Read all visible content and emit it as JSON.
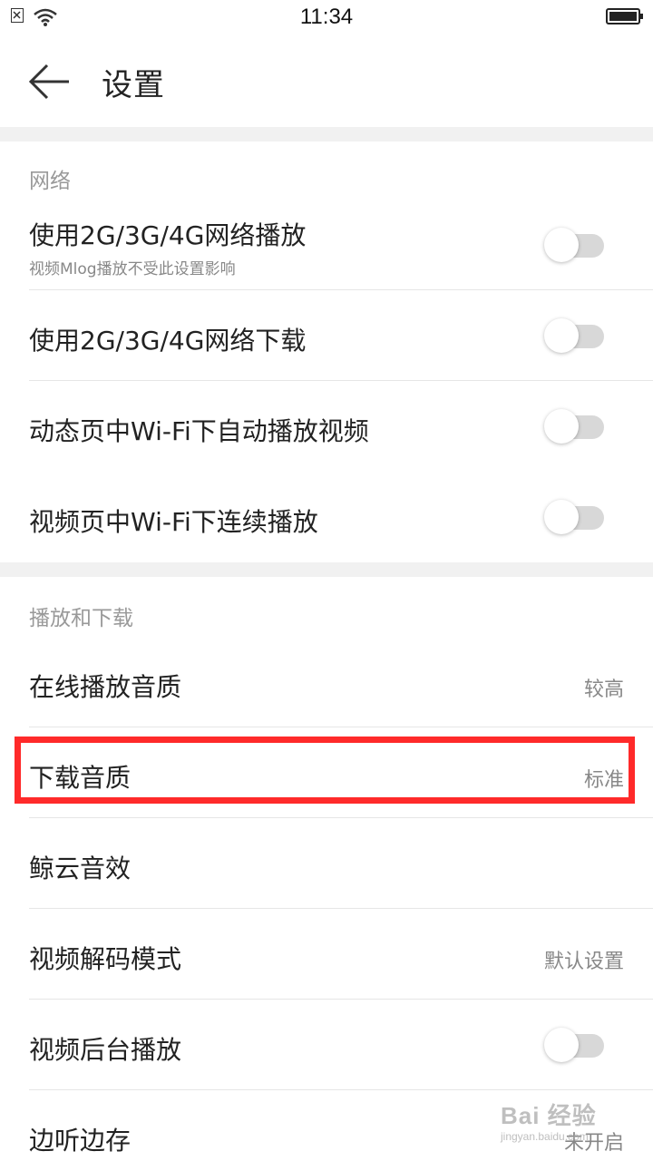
{
  "status_bar": {
    "time": "11:34",
    "icons": [
      "no-sim-icon",
      "wifi-icon",
      "battery-icon"
    ]
  },
  "app_bar": {
    "back_icon": "back-arrow-icon",
    "title": "设置"
  },
  "sections": {
    "network": {
      "header": "网络",
      "rows": [
        {
          "label": "使用2G/3G/4G网络播放",
          "sub": "视频Mlog播放不受此设置影响",
          "toggle": "off"
        },
        {
          "label": "使用2G/3G/4G网络下载",
          "toggle": "off"
        },
        {
          "label": "动态页中Wi-Fi下自动播放视频",
          "toggle": "off"
        },
        {
          "label": "视频页中Wi-Fi下连续播放",
          "toggle": "off"
        }
      ]
    },
    "playback": {
      "header": "播放和下载",
      "rows": [
        {
          "label": "在线播放音质",
          "value": "较高"
        },
        {
          "label": "下载音质",
          "value": "标准"
        },
        {
          "label": "鲸云音效"
        },
        {
          "label": "视频解码模式",
          "value": "默认设置"
        },
        {
          "label": "视频后台播放",
          "toggle": "off"
        },
        {
          "label": "边听边存",
          "value": "未开启"
        }
      ]
    }
  },
  "watermark": {
    "main": "Bai 经验",
    "sub": "jingyan.baidu.com"
  },
  "colors": {
    "highlight": "#ff2a2a",
    "section_gap": "#f1f1f1",
    "toggle_off_track": "#d8d8d8"
  }
}
